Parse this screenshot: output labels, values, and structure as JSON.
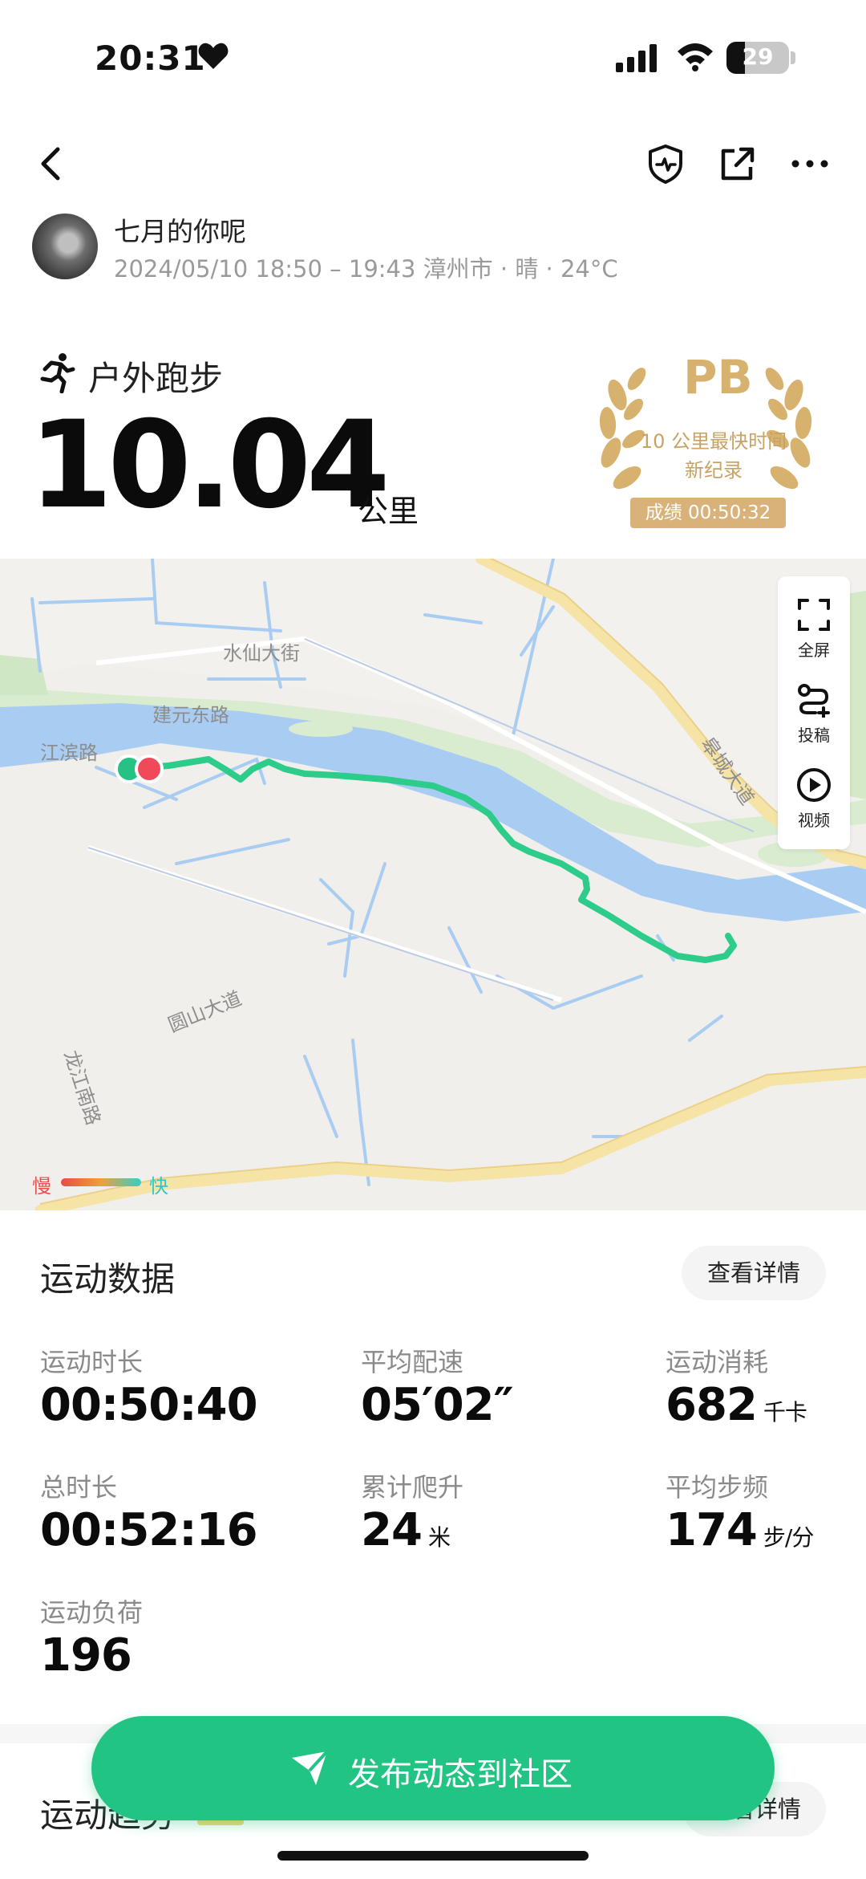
{
  "status_bar": {
    "time": "20:31",
    "battery": "29",
    "battery_level_pct": 29
  },
  "user": {
    "name": "七月的你呢",
    "meta": "2024/05/10 18:50 – 19:43 漳州市 · 晴 · 24°C"
  },
  "activity": {
    "type": "户外跑步",
    "distance": "10.04",
    "distance_unit": "公里"
  },
  "pb_badge": {
    "title": "PB",
    "line1": "10 公里最快时间",
    "line2": "新纪录",
    "score": "成绩 00:50:32"
  },
  "map": {
    "roads": [
      "水仙大街",
      "建元东路",
      "江滨路",
      "龙江南路",
      "圆山大道",
      "皋城大道"
    ],
    "toolbar": {
      "fullscreen": "全屏",
      "submit": "投稿",
      "video": "视频"
    },
    "legend": {
      "slow": "慢",
      "fast": "快"
    }
  },
  "stats": {
    "title": "运动数据",
    "detail_button": "查看详情",
    "items": [
      {
        "label": "运动时长",
        "value": "00:50:40",
        "unit": ""
      },
      {
        "label": "平均配速",
        "value": "05′02″",
        "unit": ""
      },
      {
        "label": "运动消耗",
        "value": "682",
        "unit": "千卡"
      },
      {
        "label": "总时长",
        "value": "00:52:16",
        "unit": ""
      },
      {
        "label": "累计爬升",
        "value": "24",
        "unit": "米"
      },
      {
        "label": "平均步频",
        "value": "174",
        "unit": "步/分"
      },
      {
        "label": "运动负荷",
        "value": "196",
        "unit": ""
      }
    ]
  },
  "trend": {
    "title": "运动趋势",
    "detail_button": "查看详情"
  },
  "publish_button": "发布动态到社区",
  "colors": {
    "accent": "#22c483",
    "route": "#2ecc8a",
    "river": "#a9cdf2",
    "gold": "#d7b26e"
  }
}
